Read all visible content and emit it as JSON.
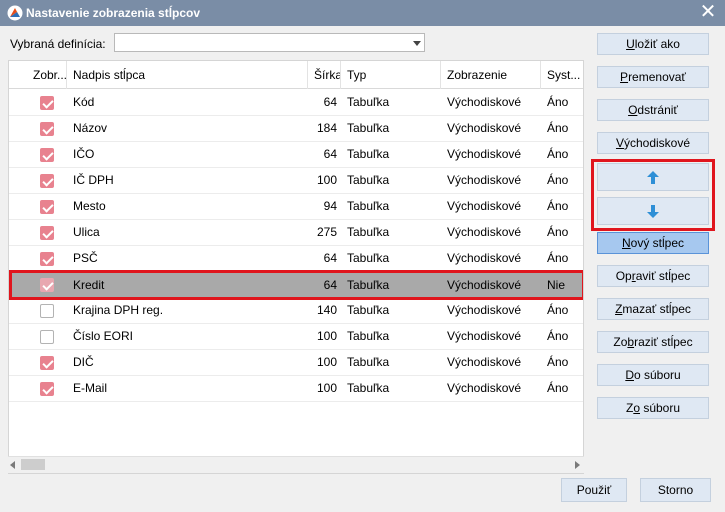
{
  "window": {
    "title": "Nastavenie zobrazenia stĺpcov",
    "close_glyph": "✕"
  },
  "definition": {
    "label": "Vybraná definícia:",
    "value": ""
  },
  "grid": {
    "columns": [
      "Zobr...",
      "Nadpis stĺpca",
      "Šírka",
      "Typ",
      "Zobrazenie",
      "Syst..."
    ],
    "rows": [
      {
        "checked": true,
        "name": "Kód",
        "width": "64",
        "type": "Tabuľka",
        "display": "Východiskové",
        "system": "Áno"
      },
      {
        "checked": true,
        "name": "Názov",
        "width": "184",
        "type": "Tabuľka",
        "display": "Východiskové",
        "system": "Áno"
      },
      {
        "checked": true,
        "name": "IČO",
        "width": "64",
        "type": "Tabuľka",
        "display": "Východiskové",
        "system": "Áno"
      },
      {
        "checked": true,
        "name": "IČ DPH",
        "width": "100",
        "type": "Tabuľka",
        "display": "Východiskové",
        "system": "Áno"
      },
      {
        "checked": true,
        "name": "Mesto",
        "width": "94",
        "type": "Tabuľka",
        "display": "Východiskové",
        "system": "Áno"
      },
      {
        "checked": true,
        "name": "Ulica",
        "width": "275",
        "type": "Tabuľka",
        "display": "Východiskové",
        "system": "Áno"
      },
      {
        "checked": true,
        "name": "PSČ",
        "width": "64",
        "type": "Tabuľka",
        "display": "Východiskové",
        "system": "Áno"
      },
      {
        "checked": true,
        "name": "Kredit",
        "width": "64",
        "type": "Tabuľka",
        "display": "Východiskové",
        "system": "Nie",
        "selected": true
      },
      {
        "checked": false,
        "name": "Krajina DPH reg.",
        "width": "140",
        "type": "Tabuľka",
        "display": "Východiskové",
        "system": "Áno"
      },
      {
        "checked": false,
        "name": "Číslo EORI",
        "width": "100",
        "type": "Tabuľka",
        "display": "Východiskové",
        "system": "Áno"
      },
      {
        "checked": true,
        "name": "DIČ",
        "width": "100",
        "type": "Tabuľka",
        "display": "Východiskové",
        "system": "Áno"
      },
      {
        "checked": true,
        "name": "E-Mail",
        "width": "100",
        "type": "Tabuľka",
        "display": "Východiskové",
        "system": "Áno"
      }
    ]
  },
  "buttons": {
    "save_as": {
      "pre": "",
      "ul": "U",
      "post": "ložiť ako"
    },
    "rename": {
      "pre": "",
      "ul": "P",
      "post": "remenovať"
    },
    "remove": {
      "pre": "",
      "ul": "O",
      "post": "dstrániť"
    },
    "default": {
      "pre": "",
      "ul": "V",
      "post": "ýchodiskové"
    },
    "new_col": {
      "pre": "",
      "ul": "N",
      "post": "ový stĺpec"
    },
    "edit_col": {
      "pre": "Op",
      "ul": "r",
      "post": "aviť stĺpec"
    },
    "del_col": {
      "pre": "",
      "ul": "Z",
      "post": "mazať stĺpec"
    },
    "show_col": {
      "pre": "Zo",
      "ul": "b",
      "post": "raziť stĺpec"
    },
    "to_file": {
      "pre": "",
      "ul": "D",
      "post": "o súboru"
    },
    "from_file": {
      "pre": "Z",
      "ul": "o",
      "post": " súboru"
    },
    "apply": {
      "pre": "",
      "ul": "P",
      "post": "oužiť"
    },
    "cancel": {
      "pre": "",
      "ul": "",
      "post": "Storno"
    }
  },
  "colors": {
    "titlebar": "#7a8da6",
    "checkbox_on": "#e8828f",
    "highlight": "#e0151d",
    "arrow": "#2e8fd6",
    "button": "#dfe8f3",
    "button_primary": "#a6c8ef"
  },
  "icons": {
    "move_up": "arrow-up-icon",
    "move_down": "arrow-down-icon"
  }
}
